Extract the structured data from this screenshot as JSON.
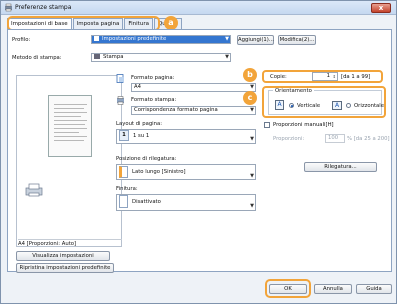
{
  "window": {
    "title": "Preferenze stampa",
    "close_glyph": "x"
  },
  "tabs": [
    {
      "label": "Impostazioni di base"
    },
    {
      "label": "Imposta pagina"
    },
    {
      "label": "Finitura"
    },
    {
      "label": "Qualità"
    }
  ],
  "badges": {
    "a": "a",
    "b": "b",
    "c": "c"
  },
  "profile": {
    "label": "Profilo:",
    "value": "Impostazioni predefinite",
    "add_button": "Aggiungi(1)...",
    "edit_button": "Modifica(2)..."
  },
  "output_method": {
    "label": "Metodo di stampa:",
    "value": "Stampa"
  },
  "page_size": {
    "label": "Formato pagina:",
    "value": "A4"
  },
  "output_size": {
    "label": "Formato stampa:",
    "value": "Corrispondenza formato pagina"
  },
  "copies": {
    "label": "Copie:",
    "value": "1",
    "range": "[da 1 a 99]"
  },
  "orientation": {
    "title": "Orientamento",
    "portrait": "Verticale",
    "landscape": "Orizzontale",
    "icon_letter": "A"
  },
  "layout": {
    "label": "Layout di pagina:",
    "value": "1 su 1",
    "icon_text": "1"
  },
  "manual_scaling": {
    "label": "Proporzioni manuali[H]",
    "scale_label": "Proporzioni:",
    "scale_value": "100",
    "scale_range": "% [da 25 a 200]"
  },
  "binding": {
    "label": "Posizione di rilegatura:",
    "value": "Lato lungo [Sinistro]",
    "gutter_button": "Rilegatura..."
  },
  "finishing": {
    "label": "Finitura:",
    "value": "Disattivato"
  },
  "preview": {
    "caption": "A4 [Proporzioni: Auto]"
  },
  "left_buttons": {
    "view_settings": "Visualizza impostazioni",
    "restore_defaults": "Ripristina impostazioni predefinite"
  },
  "footer": {
    "ok": "OK",
    "cancel": "Annulla",
    "help": "Guida"
  }
}
